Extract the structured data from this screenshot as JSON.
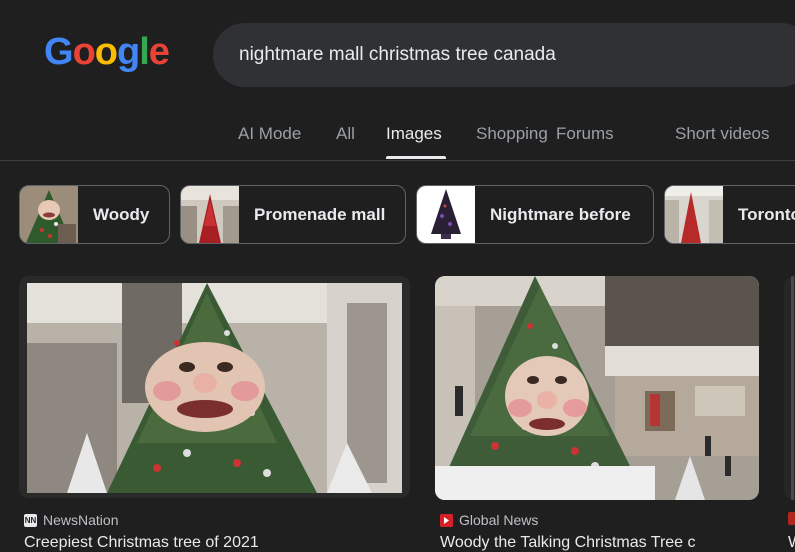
{
  "logo": {
    "letters": [
      "G",
      "o",
      "o",
      "g",
      "l",
      "e"
    ],
    "colors": [
      "#4285f4",
      "#ea4335",
      "#fbbc05",
      "#4285f4",
      "#34a853",
      "#ea4335"
    ]
  },
  "search": {
    "query": "nightmare mall christmas tree canada"
  },
  "tabs": [
    {
      "label": "AI Mode",
      "active": false
    },
    {
      "label": "All",
      "active": false
    },
    {
      "label": "Images",
      "active": true
    },
    {
      "label": "Shopping",
      "active": false
    },
    {
      "label": "Forums",
      "active": false
    },
    {
      "label": "Short videos",
      "active": false
    }
  ],
  "chips": [
    {
      "label": "Woody"
    },
    {
      "label": "Promenade mall"
    },
    {
      "label": "Nightmare before"
    },
    {
      "label": "Toronto"
    }
  ],
  "results": [
    {
      "source": "NewsNation",
      "favicon": "NN",
      "title": "Creepiest Christmas tree of 2021"
    },
    {
      "source": "Global News",
      "favicon": "",
      "title": "Woody the Talking Christmas Tree c"
    },
    {
      "source": "",
      "favicon": "",
      "title": "W"
    }
  ],
  "colors": {
    "background": "#1f1f1f",
    "search_bg": "#303134",
    "tab_inactive": "#9aa0a6",
    "tab_active": "#e8eaed"
  }
}
